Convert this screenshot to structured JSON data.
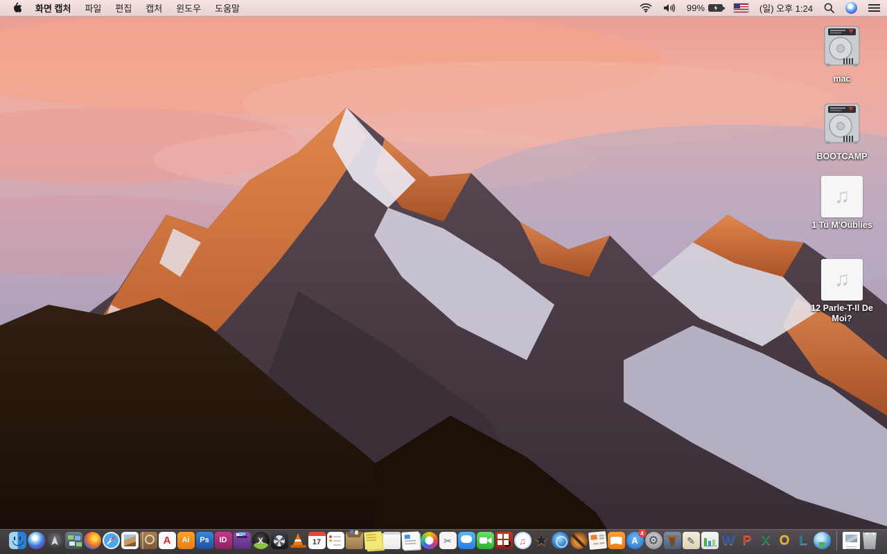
{
  "menu_bar": {
    "apple_icon": "apple-logo",
    "app_menus": [
      "화면 캡처",
      "파일",
      "편집",
      "캡처",
      "윈도우",
      "도움말"
    ],
    "status": {
      "wifi_icon": "wifi",
      "volume_icon": "volume-on",
      "battery_percent": "99%",
      "battery_state": "charging",
      "input_flag": "us-flag",
      "clock": "(일) 오후 1:24",
      "spotlight_icon": "magnifier",
      "siri_icon": "siri-orb",
      "notification_icon": "list-lines"
    }
  },
  "desktop": {
    "music_note_glyph": "♫",
    "icons": [
      {
        "label": "mac",
        "type": "hard-drive"
      },
      {
        "label": "BOOTCAMP",
        "type": "hard-drive"
      },
      {
        "label": "1 Tu M'Oublies",
        "type": "audio-file"
      },
      {
        "label": "12 Parle-T-Il De Moi?",
        "type": "audio-file"
      }
    ]
  },
  "dock": {
    "items": [
      "finder",
      "siri",
      "launchpad",
      "mission-control",
      "firefox",
      "safari",
      "preview",
      "contacts",
      "acrobat-reader",
      "illustrator",
      "photoshop",
      "indesign",
      "toast-titanium",
      "x-sphere-app",
      "fan-utility-app",
      "vlc",
      "calendar",
      "reminders",
      "archive-box-app",
      "stickies",
      "notepad-app",
      "document-viewer-app",
      "photos",
      "screen-capture-grab",
      "messages",
      "facetime",
      "photo-grid-app",
      "itunes",
      "imovie-hd",
      "idvd",
      "garageband",
      "newsletter-app",
      "ibooks",
      "app-store",
      "system-preferences",
      "keynote",
      "pages",
      "numbers",
      "word",
      "powerpoint",
      "excel",
      "outlook",
      "lync",
      "download-globe-app",
      "document-file",
      "trash-full"
    ],
    "running": [
      "finder",
      "screen-capture-grab"
    ],
    "glyphs": {
      "acrobat": "A",
      "illustrator": "Ai",
      "photoshop": "Ps",
      "indesign": "ID",
      "xsphere": "X",
      "calendar_day": "17",
      "scissors": "✂",
      "itunes_note": "♫",
      "imovie_star": "★",
      "appstore_a": "A",
      "gear": "⚙",
      "pages_pen": "✎",
      "word": "W",
      "powerpoint": "P",
      "excel": "X",
      "outlook": "O",
      "lync": "L"
    },
    "badges": {
      "app_store": "4"
    }
  },
  "colors": {
    "menubar_bg": "#f0dcdb",
    "dock_bg": "rgba(84,82,86,0.65)",
    "sky_pink": "#f0ab9c",
    "sky_lavender": "#a79fba",
    "sunlit_orange": "#d97a3c",
    "rock_dark": "#3a2f38",
    "foreground_rock": "#241610",
    "snow": "#e9e6f0",
    "badge_red": "#e8413c"
  }
}
